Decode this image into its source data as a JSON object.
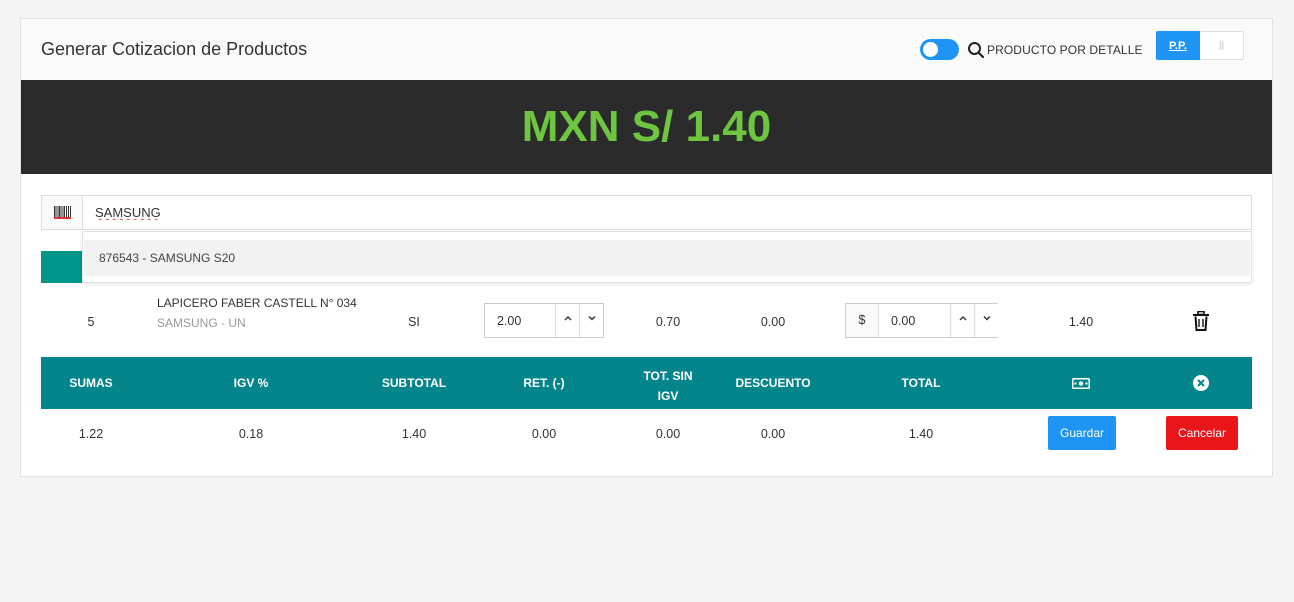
{
  "header": {
    "title": "Generar Cotizacion de Productos",
    "detail_label": "PRODUCTO POR DETALLE",
    "pp_button": "P.P.",
    "alt_button": "||",
    "toggle_on": true,
    "accent": "#1e95f4"
  },
  "banner": {
    "total_display": "MXN S/ 1.40",
    "text_color": "#6ec640",
    "background": "#2b2b2b"
  },
  "search": {
    "value": "SAMSUNG",
    "icon": "barcode-icon"
  },
  "dropdown": {
    "items": [
      "876543 - SAMSUNG S20"
    ]
  },
  "item_row": {
    "index": "5",
    "product_name": "LAPICERO FABER CASTELL N° 034",
    "product_sub": "SAMSUNG - UN",
    "flag": "SI",
    "quantity": "2.00",
    "unit_price": "0.70",
    "discount": "0.00",
    "currency_symbol": "$",
    "extra_value": "0.00",
    "total": "1.40"
  },
  "totals": {
    "headers": [
      "SUMAS",
      "IGV %",
      "SUBTOTAL",
      "RET. (-)",
      "TOT. SIN IGV",
      "DESCUENTO",
      "TOTAL"
    ],
    "values": [
      "1.22",
      "0.18",
      "1.40",
      "0.00",
      "0.00",
      "0.00",
      "1.40"
    ],
    "header_bg": "#03858b",
    "save_label": "Guardar",
    "cancel_label": "Cancelar"
  }
}
